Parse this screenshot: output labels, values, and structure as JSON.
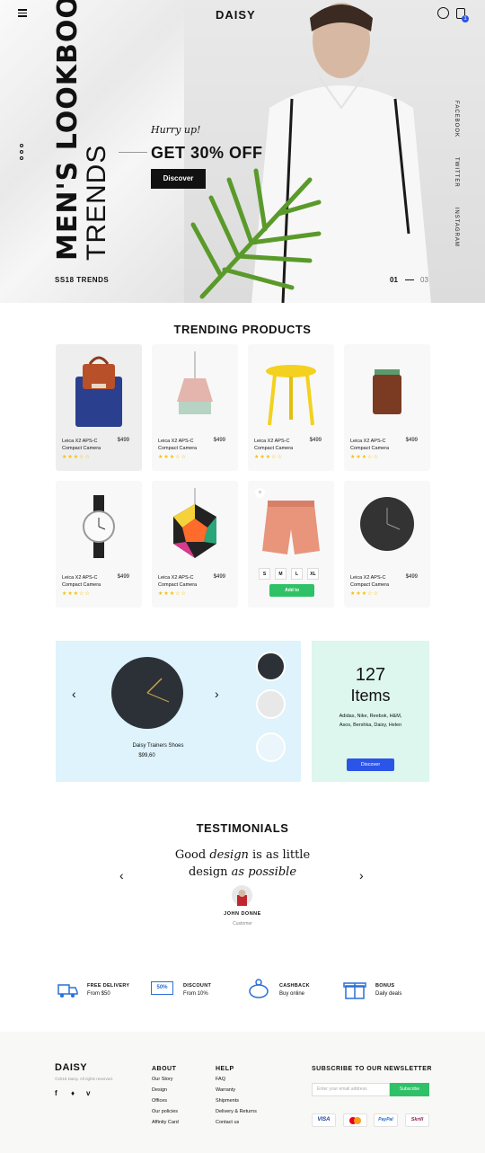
{
  "header": {
    "brand": "DAISY",
    "cart_count": "1"
  },
  "hero": {
    "title_bold": "MEN'S LOOKBOOK",
    "title_light": "TRENDS",
    "season": "SS18 TRENDS",
    "hurry": "Hurry up!",
    "offer": "GET 30% OFF",
    "button": "Discover",
    "social": [
      "FACEBOOK",
      "TWITTER",
      "INSTAGRAM"
    ],
    "slide_current": "01",
    "slide_total": "03"
  },
  "trending": {
    "title": "TRENDING PRODUCTS",
    "product_name_1": "Leica X2 APS-C",
    "product_name_2": "Compact Camera",
    "price": "$499",
    "stars": "★★★☆☆",
    "sizes": [
      "S",
      "M",
      "L",
      "XL"
    ],
    "add_label": "Add to"
  },
  "feature": {
    "product": "Daisy Trainers Shoes",
    "price": "$99,60",
    "count": "127",
    "count_label": "Items",
    "brands": "Adidas, Nike, Reebok, H&M, Asos, Bershka, Daisy, Helen",
    "button": "Discover"
  },
  "testimonials": {
    "title": "TESTIMONIALS",
    "q1": "Good ",
    "q2": "design",
    "q3": " is as little",
    "q4": "design ",
    "q5": "as possible",
    "name": "JOHN DONNE",
    "role": "Customer"
  },
  "benefits": [
    {
      "title": "FREE DELIVERY",
      "sub": "From $50",
      "icon": "truck-icon"
    },
    {
      "title": "DISCOUNT",
      "sub": "From 10%",
      "icon": "coupon-icon",
      "badge": "50%"
    },
    {
      "title": "CASHBACK",
      "sub": "Buy online",
      "icon": "piggy-bank-icon"
    },
    {
      "title": "BONUS",
      "sub": "Daily deals",
      "icon": "gift-icon"
    }
  ],
  "footer": {
    "brand": "DAISY",
    "copyright": "©2018 Daisy. All rights reserved.",
    "about_title": "ABOUT",
    "about": [
      "Our Story",
      "Design",
      "Offices",
      "Our policies",
      "Affinity Card"
    ],
    "help_title": "HELP",
    "help": [
      "FAQ",
      "Warranty",
      "Shipments",
      "Delivery & Returns",
      "Contact us"
    ],
    "newsletter_title": "SUBSCRIBE TO OUR NEWSLETTER",
    "email_placeholder": "Enter your email address",
    "subscribe": "Subscribe",
    "payments": [
      "VISA",
      "mastercard",
      "PayPal",
      "Skrill"
    ]
  },
  "colors": {
    "blue": "#2b54e8",
    "green": "#2fc167",
    "star": "#f2c200"
  }
}
